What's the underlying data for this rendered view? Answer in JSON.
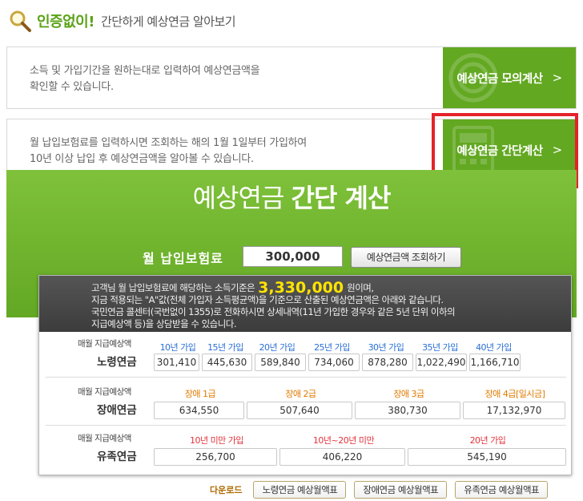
{
  "header": {
    "title": "인증없이!",
    "subtitle": "간단하게 예상연금 알아보기"
  },
  "options": [
    {
      "desc_line1": "소득 및 가입기간을 원하는대로 입력하여 예상연금액을",
      "desc_line2": "확인할 수 있습니다.",
      "button": "예상연금 모의계산",
      "arrow": ">"
    },
    {
      "desc_line1": "월 납입보험료를 입력하시면 조회하는 해의 1월 1일부터 가입하여",
      "desc_line2": "10년 이상 납입 후 예상연금액을 알아볼 수 있습니다.",
      "button": "예상연금 간단계산",
      "arrow": ">"
    }
  ],
  "calc": {
    "title_light": "예상연금",
    "title_bold": "간단 계산",
    "premium_label": "월 납입보험료",
    "premium_value": "300,000",
    "query_button": "예상연금액 조회하기"
  },
  "notice": {
    "line1_pre": "고객님 월 납입보험료에 해당하는 소득기준은",
    "amount": "3,330,000",
    "line1_post": "원이며,",
    "line2": "지금 적용되는 \"A\"값(전체 가입자 소득평균액)을 기준으로 산출된 예상연금액은 아래와 같습니다.",
    "line3": "국민연금 콜센터(국번없이 1355)로 전화하시면 상세내역(11년 가입한 경우와 같은 5년 단위 이하의",
    "line4": "지급예상액 등)을 상담받을 수 있습니다."
  },
  "sections": [
    {
      "label": "매월 지급예상액",
      "name": "노령연금",
      "headers": [
        "10년 가입",
        "15년 가입",
        "20년 가입",
        "25년 가입",
        "30년 가입",
        "35년 가입",
        "40년 가입"
      ],
      "values": [
        "301,410",
        "445,630",
        "589,840",
        "734,060",
        "878,280",
        "1,022,490",
        "1,166,710"
      ]
    },
    {
      "label": "매월 지급예상액",
      "name": "장애연금",
      "headers": [
        "장애 1급",
        "장애 2급",
        "장애 3급",
        "장애 4급[일시금]"
      ],
      "values": [
        "634,550",
        "507,640",
        "380,730",
        "17,132,970"
      ]
    },
    {
      "label": "매월 지급예상액",
      "name": "유족연금",
      "headers": [
        "10년 미만 가입",
        "10년~20년 미만",
        "20년 가입"
      ],
      "values": [
        "256,700",
        "406,220",
        "545,190"
      ]
    }
  ],
  "downloads": {
    "label": "다운로드",
    "buttons": [
      "노령연금 예상월액표",
      "장애연금 예상월액표",
      "유족연금 예상월액표"
    ]
  },
  "colors": {
    "brand_green": "#62a821",
    "highlight_red": "#e4222a",
    "amount_yellow": "#ffe400"
  }
}
